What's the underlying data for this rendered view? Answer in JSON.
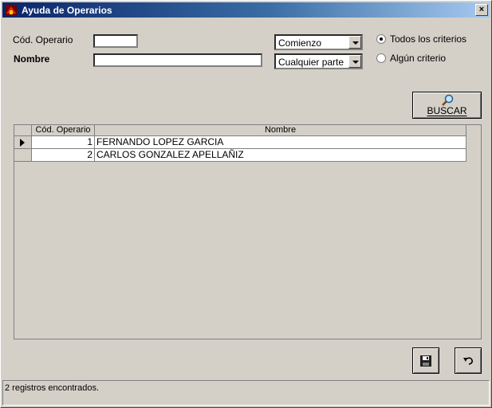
{
  "window": {
    "title": "Ayuda de Operarios",
    "close_glyph": "×"
  },
  "form": {
    "cod_label": "Cód. Operario",
    "cod_value": "",
    "nombre_label": "Nombre",
    "nombre_value": "",
    "match_select": "Comienzo",
    "scope_select": "Cualquier parte",
    "radio_all": "Todos los criterios",
    "radio_any": "Algún criterio",
    "search_button": "BUSCAR"
  },
  "table": {
    "columns": [
      "Cód. Operario",
      "Nombre"
    ],
    "rows": [
      {
        "codigo": "1",
        "nombre": "FERNANDO LOPEZ GARCIA"
      },
      {
        "codigo": "2",
        "nombre": "CARLOS GONZALEZ APELLAÑIZ"
      }
    ]
  },
  "status": {
    "text": "2 registros encontrados."
  },
  "icons": {
    "title": "app-icon",
    "search": "magnifier-icon",
    "save": "floppy-disk-icon",
    "undo": "undo-arrow-icon"
  }
}
